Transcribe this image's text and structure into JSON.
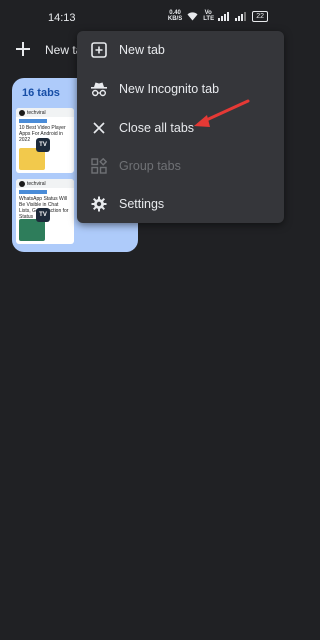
{
  "status_bar": {
    "time": "14:13",
    "net_speed_value": "0.40",
    "net_speed_unit": "KB/S",
    "battery": "22",
    "network_label": "Vo LTE"
  },
  "toolbar": {
    "new_tab_label": "New ta"
  },
  "tab_group": {
    "count_label": "16 tabs",
    "thumbnails": [
      {
        "site": "techviral",
        "title": "10 Best Video Player Apps For Android in 2022",
        "badge": "TV"
      },
      {
        "site": "techviral",
        "title": "WhatsApp Status Will Be Visible in Chat Lists, Get Reaction for Status",
        "badge": "TV"
      }
    ]
  },
  "menu": {
    "items": [
      {
        "label": "New tab",
        "icon": "new-tab-icon",
        "enabled": true
      },
      {
        "label": "New Incognito tab",
        "icon": "incognito-icon",
        "enabled": true
      },
      {
        "label": "Close all tabs",
        "icon": "close-icon",
        "enabled": true
      },
      {
        "label": "Group tabs",
        "icon": "group-tabs-icon",
        "enabled": false
      },
      {
        "label": "Settings",
        "icon": "gear-icon",
        "enabled": true
      }
    ]
  },
  "colors": {
    "background": "#202124",
    "menu_background": "#35363a",
    "group_card": "#aecbfa",
    "annotation_arrow": "#e53935"
  }
}
